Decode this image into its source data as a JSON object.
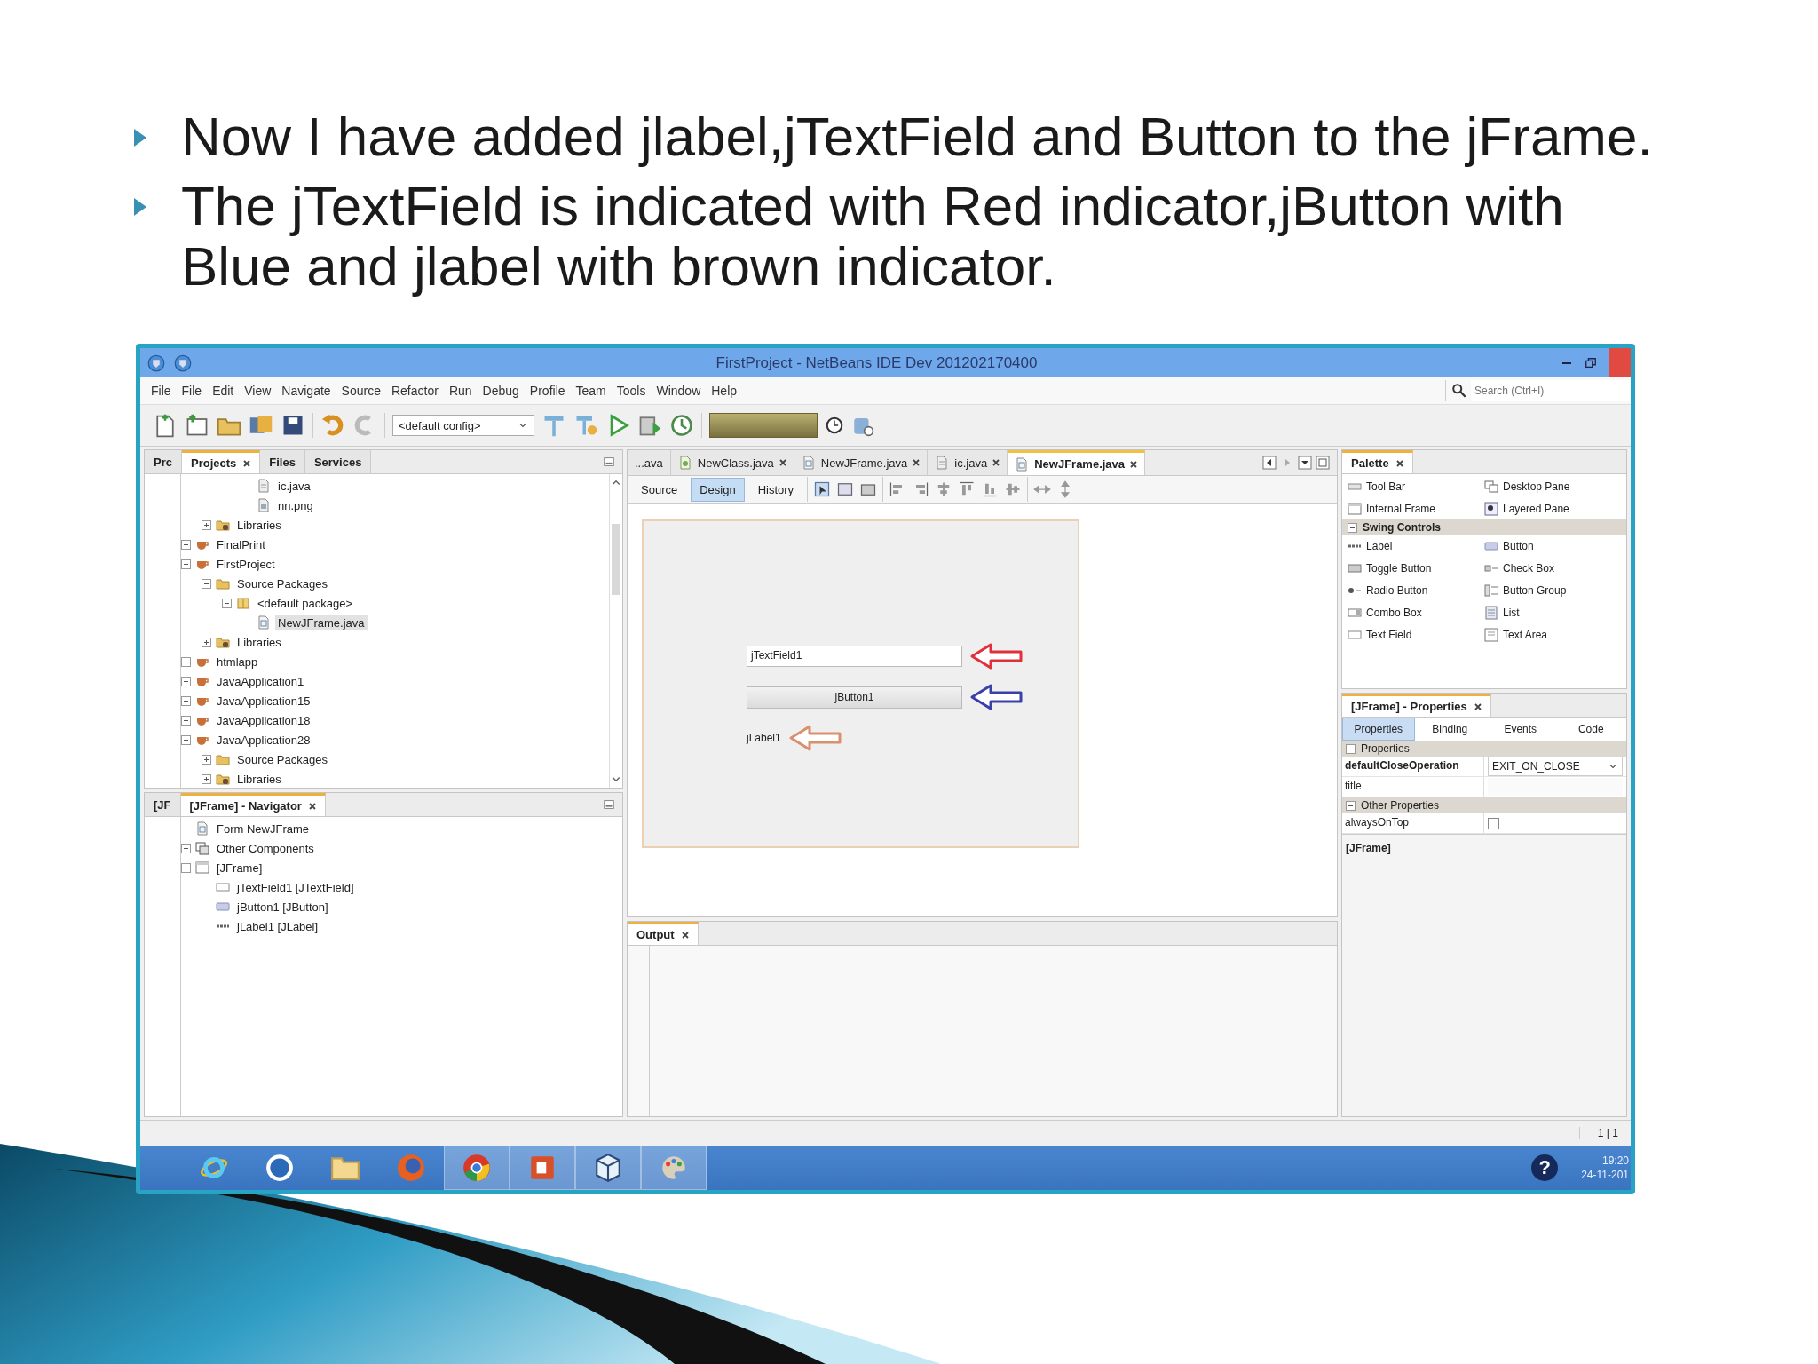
{
  "slide": {
    "bullets": [
      "Now I have added jlabel,jTextField and Button to the jFrame.",
      "The jTextField is indicated with Red indicator,jButton with Blue and jlabel with brown indicator."
    ]
  },
  "window": {
    "title": "FirstProject - NetBeans IDE Dev 201202170400"
  },
  "menu": [
    "File",
    "File",
    "Edit",
    "View",
    "Navigate",
    "Source",
    "Refactor",
    "Run",
    "Debug",
    "Profile",
    "Team",
    "Tools",
    "Window",
    "Help"
  ],
  "search": {
    "placeholder": "Search (Ctrl+I)"
  },
  "toolbar": {
    "config": "<default config>"
  },
  "projects_panel": {
    "tabs": [
      {
        "label": "Prc",
        "selected": false,
        "closable": false
      },
      {
        "label": "Projects",
        "selected": true,
        "closable": true
      },
      {
        "label": "Files",
        "selected": false,
        "closable": false
      },
      {
        "label": "Services",
        "selected": false,
        "closable": false
      }
    ],
    "tree": [
      {
        "children": [
          {
            "children": [
              {
                "children": [
                  {
                    "label": "ic.java",
                    "kind": "file",
                    "selected": false
                  },
                  {
                    "label": "nn.png",
                    "kind": "image",
                    "selected": false
                  }
                ]
              }
            ]
          },
          {
            "label": "Libraries",
            "kind": "library",
            "expanded": false,
            "selected": false
          }
        ]
      },
      {
        "label": "FinalPrint",
        "kind": "project",
        "expanded": false,
        "selected": false
      },
      {
        "label": "FirstProject",
        "kind": "project",
        "expanded": true,
        "selected": false,
        "children": [
          {
            "label": "Source Packages",
            "kind": "folder",
            "expanded": true,
            "selected": false,
            "children": [
              {
                "label": "<default package>",
                "kind": "package",
                "expanded": true,
                "selected": false,
                "children": [
                  {
                    "label": "NewJFrame.java",
                    "kind": "form",
                    "selected": true
                  }
                ]
              }
            ]
          },
          {
            "label": "Libraries",
            "kind": "library",
            "expanded": false,
            "selected": false
          }
        ]
      },
      {
        "label": "htmlapp",
        "kind": "project",
        "expanded": false,
        "selected": false
      },
      {
        "label": "JavaApplication1",
        "kind": "project",
        "expanded": false,
        "selected": false
      },
      {
        "label": "JavaApplication15",
        "kind": "project",
        "expanded": false,
        "selected": false
      },
      {
        "label": "JavaApplication18",
        "kind": "project",
        "expanded": false,
        "selected": false
      },
      {
        "label": "JavaApplication28",
        "kind": "project",
        "expanded": true,
        "selected": false,
        "children": [
          {
            "label": "Source Packages",
            "kind": "folder",
            "expanded": false,
            "selected": false
          },
          {
            "label": "Libraries",
            "kind": "library",
            "expanded": false,
            "selected": false
          }
        ]
      }
    ]
  },
  "navigator": {
    "tabs": [
      {
        "label": "[JF",
        "selected": false,
        "closable": false
      },
      {
        "label": "[JFrame] - Navigator",
        "selected": true,
        "closable": true
      }
    ],
    "tree": [
      {
        "label": "Form NewJFrame",
        "kind": "form"
      },
      {
        "label": "Other Components",
        "kind": "components",
        "expanded": false
      },
      {
        "label": "[JFrame]",
        "kind": "frame",
        "expanded": true,
        "children": [
          {
            "label": "jTextField1 [JTextField]",
            "kind": "textfield"
          },
          {
            "label": "jButton1 [JButton]",
            "kind": "button"
          },
          {
            "label": "jLabel1 [JLabel]",
            "kind": "label"
          }
        ]
      }
    ]
  },
  "editor": {
    "tabs": [
      {
        "label": "...ava",
        "kind": "overflow",
        "selected": false
      },
      {
        "label": "NewClass.java",
        "kind": "class",
        "selected": false
      },
      {
        "label": "NewJFrame.java",
        "kind": "form",
        "selected": false
      },
      {
        "label": "ic.java",
        "kind": "file",
        "selected": false
      },
      {
        "label": "NewJFrame.java",
        "kind": "form",
        "selected": true
      }
    ],
    "views": [
      {
        "label": "Source",
        "selected": false
      },
      {
        "label": "Design",
        "selected": true
      },
      {
        "label": "History",
        "selected": false
      }
    ],
    "form": {
      "components": [
        {
          "kind": "textfield",
          "text": "jTextField1",
          "color": "#e0303a"
        },
        {
          "kind": "button",
          "text": "jButton1",
          "color": "#3b40a8"
        },
        {
          "kind": "label",
          "text": "jLabel1",
          "color": "#d9906e"
        }
      ]
    }
  },
  "palette": {
    "title": "Palette",
    "sections": [
      {
        "items": [
          {
            "label": "Tool Bar",
            "kind": "toolbar"
          },
          {
            "label": "Desktop Pane",
            "kind": "desktop"
          },
          {
            "label": "Internal Frame",
            "kind": "frame"
          },
          {
            "label": "Layered Pane",
            "kind": "layered"
          }
        ]
      },
      {
        "title": "Swing Controls",
        "expanded": true,
        "items": [
          {
            "label": "Label",
            "kind": "label"
          },
          {
            "label": "Button",
            "kind": "button"
          },
          {
            "label": "Toggle Button",
            "kind": "toggle"
          },
          {
            "label": "Check Box",
            "kind": "checkbox"
          },
          {
            "label": "Radio Button",
            "kind": "radio"
          },
          {
            "label": "Button Group",
            "kind": "group"
          },
          {
            "label": "Combo Box",
            "kind": "combo"
          },
          {
            "label": "List",
            "kind": "list"
          },
          {
            "label": "Text Field",
            "kind": "textfield"
          },
          {
            "label": "Text Area",
            "kind": "textarea"
          }
        ]
      }
    ]
  },
  "properties": {
    "title": "[JFrame] - Properties",
    "tabs": [
      {
        "label": "Properties",
        "selected": true
      },
      {
        "label": "Binding",
        "selected": false
      },
      {
        "label": "Events",
        "selected": false
      },
      {
        "label": "Code",
        "selected": false
      }
    ],
    "groups": [
      {
        "title": "Properties",
        "expanded": true,
        "rows": [
          {
            "name": "defaultCloseOperation",
            "bold": true,
            "kind": "dropdown",
            "value": "EXIT_ON_CLOSE"
          },
          {
            "name": "title",
            "bold": false,
            "kind": "text"
          }
        ]
      },
      {
        "title": "Other Properties",
        "expanded": true,
        "rows": [
          {
            "name": "alwaysOnTop",
            "bold": false,
            "kind": "checkbox",
            "checked": false
          }
        ]
      }
    ],
    "description": "[JFrame]"
  },
  "output": {
    "title": "Output"
  },
  "status_bar": {
    "position": "1 | 1"
  },
  "taskbar": {
    "apps": [
      {
        "kind": "ie",
        "running": false
      },
      {
        "kind": "hp",
        "running": false
      },
      {
        "kind": "files",
        "running": false
      },
      {
        "kind": "firefox",
        "running": false
      },
      {
        "kind": "chrome",
        "running": true
      },
      {
        "kind": "powerpoint",
        "running": true
      },
      {
        "kind": "cube",
        "running": true
      },
      {
        "kind": "paint",
        "running": true
      }
    ],
    "help": "?",
    "time": "19:20",
    "date": "24-11-201"
  }
}
